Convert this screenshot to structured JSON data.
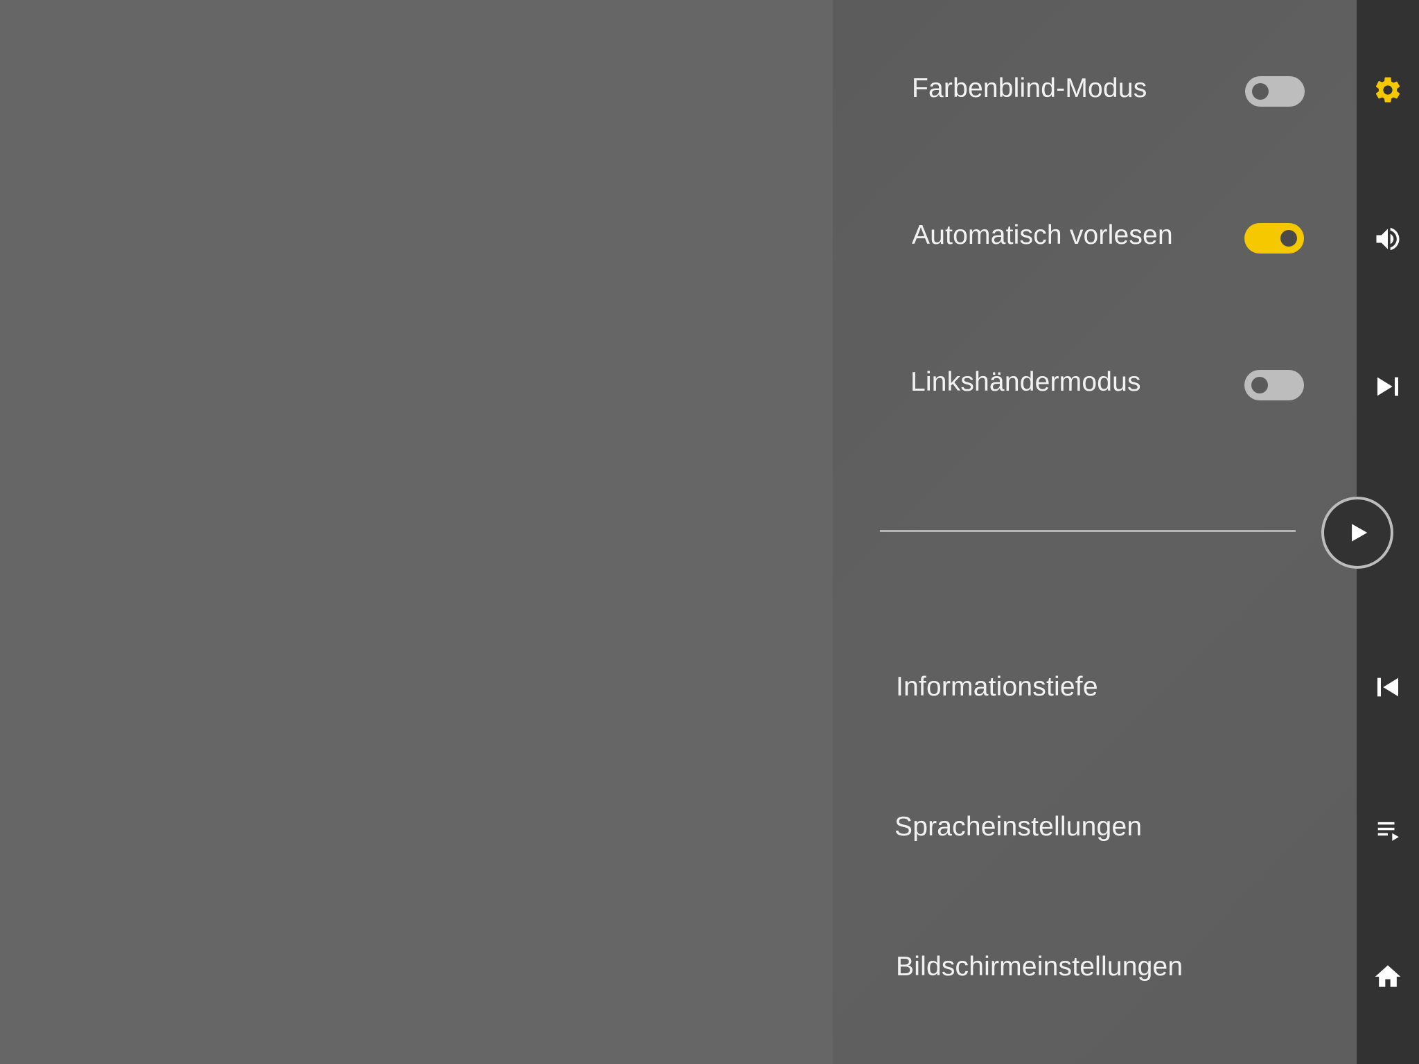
{
  "settings": {
    "colorblind": {
      "label": "Farbenblind-Modus",
      "enabled": false
    },
    "autoread": {
      "label": "Automatisch vorlesen",
      "enabled": true
    },
    "lefthand": {
      "label": "Linkshändermodus",
      "enabled": false
    }
  },
  "menu": {
    "info_depth": "Informationstiefe",
    "language": "Spracheinstellungen",
    "display": "Bildschirmeinstellungen"
  },
  "rail": {
    "icons": [
      "gear-icon",
      "speaker-icon",
      "skip-next-icon",
      "play-icon",
      "skip-previous-icon",
      "playlist-icon",
      "home-icon"
    ]
  },
  "colors": {
    "accent": "#f5c800",
    "panel": "#5e5e5e",
    "rail": "#323232",
    "background": "#666666"
  }
}
